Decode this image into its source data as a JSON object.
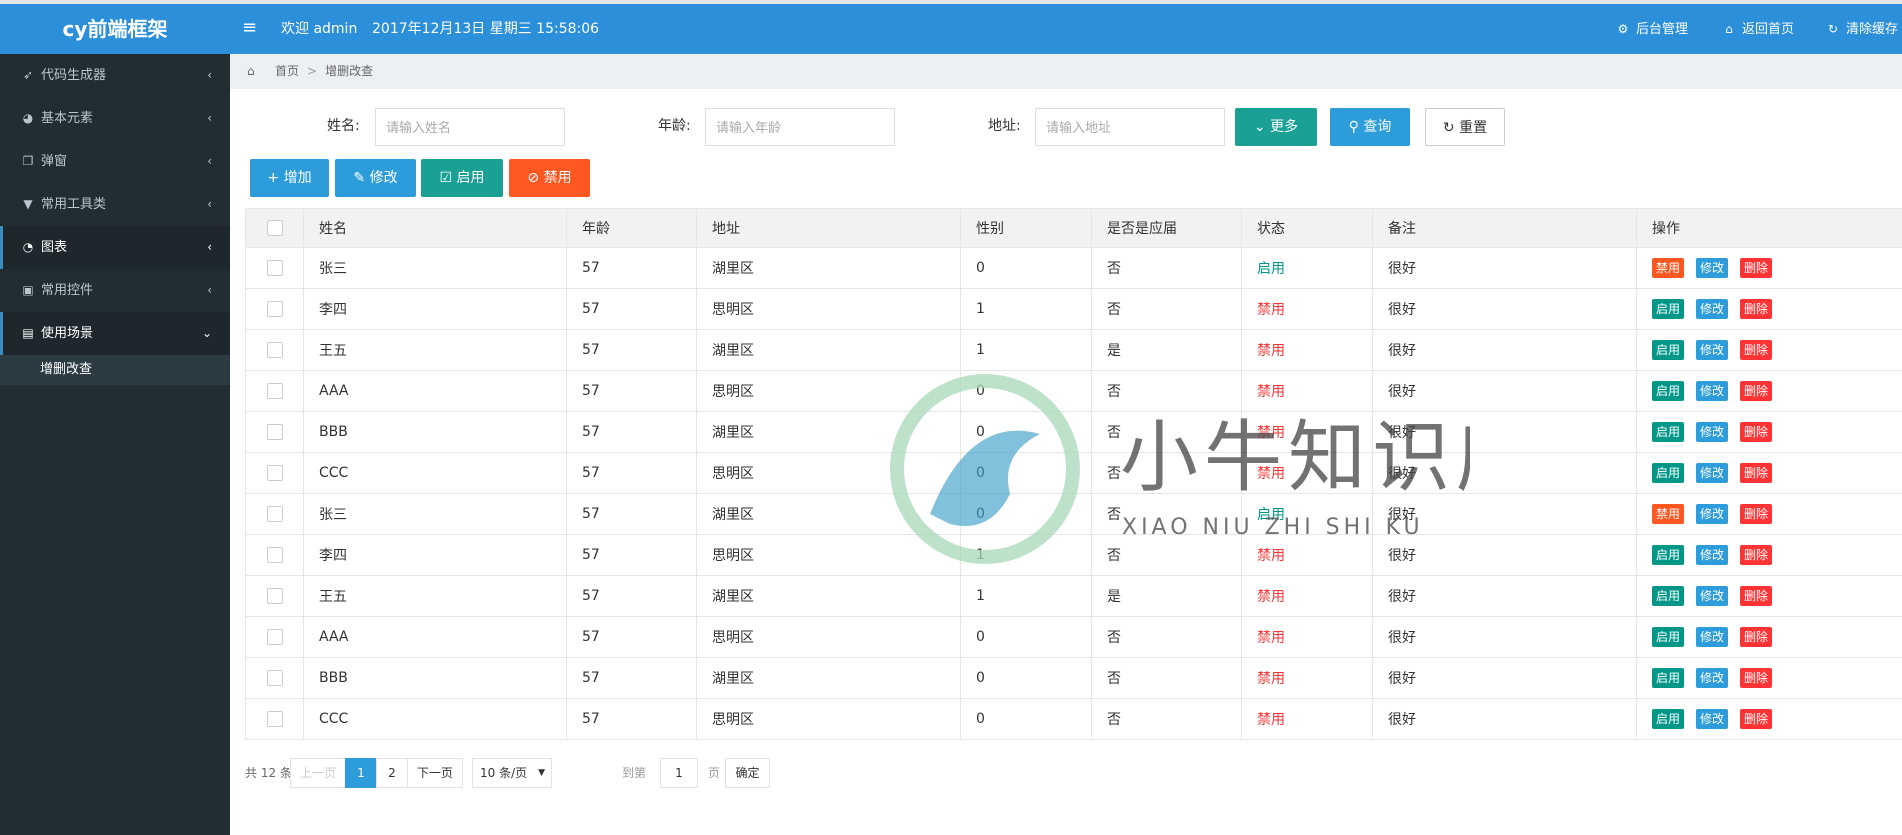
{
  "app": {
    "logo": "cy前端框架"
  },
  "header": {
    "welcome": "欢迎 admin",
    "datetime": "2017年12月13日 星期三 15:58:06",
    "nav": [
      {
        "label": "后台管理",
        "icon": "gear-icon"
      },
      {
        "label": "返回首页",
        "icon": "home-icon"
      },
      {
        "label": "清除缓存",
        "icon": "refresh-icon"
      }
    ]
  },
  "sidebar": {
    "items": [
      {
        "label": "代码生成器",
        "icon": "rocket-icon"
      },
      {
        "label": "基本元素",
        "icon": "dashboard-icon"
      },
      {
        "label": "弹窗",
        "icon": "window-icon"
      },
      {
        "label": "常用工具类",
        "icon": "html5-icon"
      },
      {
        "label": "图表",
        "icon": "pie-chart-icon"
      },
      {
        "label": "常用控件",
        "icon": "inbox-icon"
      },
      {
        "label": "使用场景",
        "icon": "id-card-icon"
      }
    ],
    "sub_items": [
      {
        "label": "增删改查"
      }
    ]
  },
  "breadcrumb": {
    "home": "首页",
    "current": "增删改查"
  },
  "filters": {
    "name_label": "姓名:",
    "name_placeholder": "请输入姓名",
    "age_label": "年龄:",
    "age_placeholder": "请输入年龄",
    "addr_label": "地址:",
    "addr_placeholder": "请输入地址",
    "more": "更多",
    "query": "查询",
    "reset": "重置"
  },
  "actions": {
    "add": "增加",
    "edit": "修改",
    "enable": "启用",
    "disable": "禁用"
  },
  "table": {
    "headers": [
      "姓名",
      "年龄",
      "地址",
      "性别",
      "是否是应届",
      "状态",
      "备注",
      "操作"
    ],
    "rows": [
      {
        "name": "张三",
        "age": "57",
        "addr": "湖里区",
        "sex": "0",
        "grad": "否",
        "status": "启用",
        "note": "很好",
        "toggle": "禁用"
      },
      {
        "name": "李四",
        "age": "57",
        "addr": "思明区",
        "sex": "1",
        "grad": "否",
        "status": "禁用",
        "note": "很好",
        "toggle": "启用"
      },
      {
        "name": "王五",
        "age": "57",
        "addr": "湖里区",
        "sex": "1",
        "grad": "是",
        "status": "禁用",
        "note": "很好",
        "toggle": "启用"
      },
      {
        "name": "AAA",
        "age": "57",
        "addr": "思明区",
        "sex": "0",
        "grad": "否",
        "status": "禁用",
        "note": "很好",
        "toggle": "启用"
      },
      {
        "name": "BBB",
        "age": "57",
        "addr": "湖里区",
        "sex": "0",
        "grad": "否",
        "status": "禁用",
        "note": "很好",
        "toggle": "启用"
      },
      {
        "name": "CCC",
        "age": "57",
        "addr": "思明区",
        "sex": "0",
        "grad": "否",
        "status": "禁用",
        "note": "很好",
        "toggle": "启用"
      },
      {
        "name": "张三",
        "age": "57",
        "addr": "湖里区",
        "sex": "0",
        "grad": "否",
        "status": "启用",
        "note": "很好",
        "toggle": "禁用"
      },
      {
        "name": "李四",
        "age": "57",
        "addr": "思明区",
        "sex": "1",
        "grad": "否",
        "status": "禁用",
        "note": "很好",
        "toggle": "启用"
      },
      {
        "name": "王五",
        "age": "57",
        "addr": "湖里区",
        "sex": "1",
        "grad": "是",
        "status": "禁用",
        "note": "很好",
        "toggle": "启用"
      },
      {
        "name": "AAA",
        "age": "57",
        "addr": "思明区",
        "sex": "0",
        "grad": "否",
        "status": "禁用",
        "note": "很好",
        "toggle": "启用"
      },
      {
        "name": "BBB",
        "age": "57",
        "addr": "湖里区",
        "sex": "0",
        "grad": "否",
        "status": "禁用",
        "note": "很好",
        "toggle": "启用"
      },
      {
        "name": "CCC",
        "age": "57",
        "addr": "思明区",
        "sex": "0",
        "grad": "否",
        "status": "禁用",
        "note": "很好",
        "toggle": "启用"
      }
    ],
    "row_edit": "修改",
    "row_delete": "删除"
  },
  "pagination": {
    "total": "共 12 条",
    "prev": "上一页",
    "pages": [
      "1",
      "2"
    ],
    "current": "1",
    "next": "下一页",
    "page_size": "10 条/页",
    "goto_label": "到第",
    "goto_value": "1",
    "page_unit": "页",
    "confirm": "确定"
  },
  "watermark": {
    "text": "小牛知识库",
    "subtext": "XIAO NIU ZHI SHI KU"
  },
  "colors": {
    "header": "#2b8fd9",
    "sidebar": "#222d32",
    "enabled": "#009688",
    "disabled": "#ff3333",
    "warn": "#ff5722",
    "primary": "#2d9cdb"
  }
}
